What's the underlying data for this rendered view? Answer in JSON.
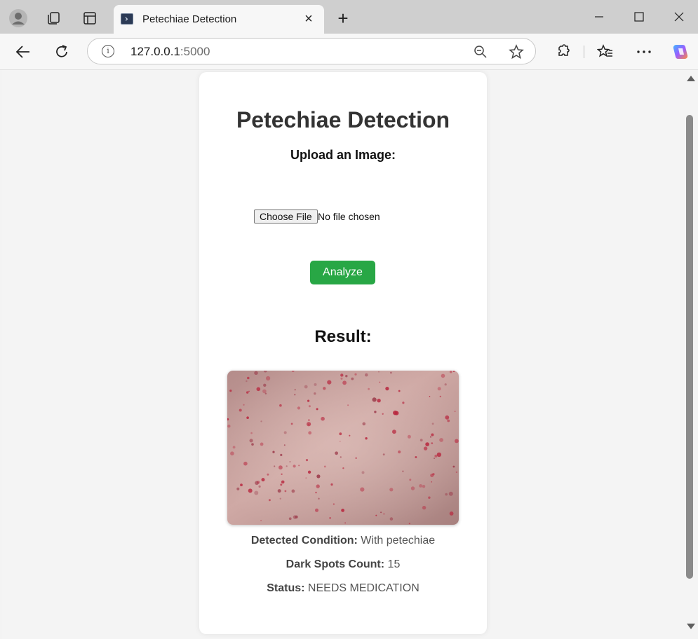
{
  "browser": {
    "tab_title": "Petechiae Detection",
    "tab_close": "×",
    "new_tab": "+",
    "url_host": "127.0.0.1",
    "url_port": ":5000"
  },
  "page": {
    "title": "Petechiae Detection",
    "upload_label": "Upload an Image:",
    "choose_file_button": "Choose File",
    "no_file_text": "No file chosen",
    "analyze_button": "Analyze",
    "result_heading": "Result:",
    "detected_condition_label": "Detected Condition:",
    "detected_condition_value": "With petechiae",
    "dark_spots_label": "Dark Spots Count:",
    "dark_spots_value": "15",
    "status_label": "Status:",
    "status_value": "NEEDS MEDICATION"
  },
  "colors": {
    "analyze_button": "#28a745",
    "skin_base": "#c9a19c",
    "spot": "#b8283f"
  },
  "icons": [
    "profile-icon",
    "workspaces-icon",
    "tab-actions-icon",
    "minimize-icon",
    "maximize-icon",
    "close-window-icon",
    "back-icon",
    "refresh-icon",
    "info-icon",
    "zoom-out-icon",
    "favorite-star-icon",
    "extensions-icon",
    "favorites-icon",
    "more-icon",
    "copilot-icon"
  ]
}
